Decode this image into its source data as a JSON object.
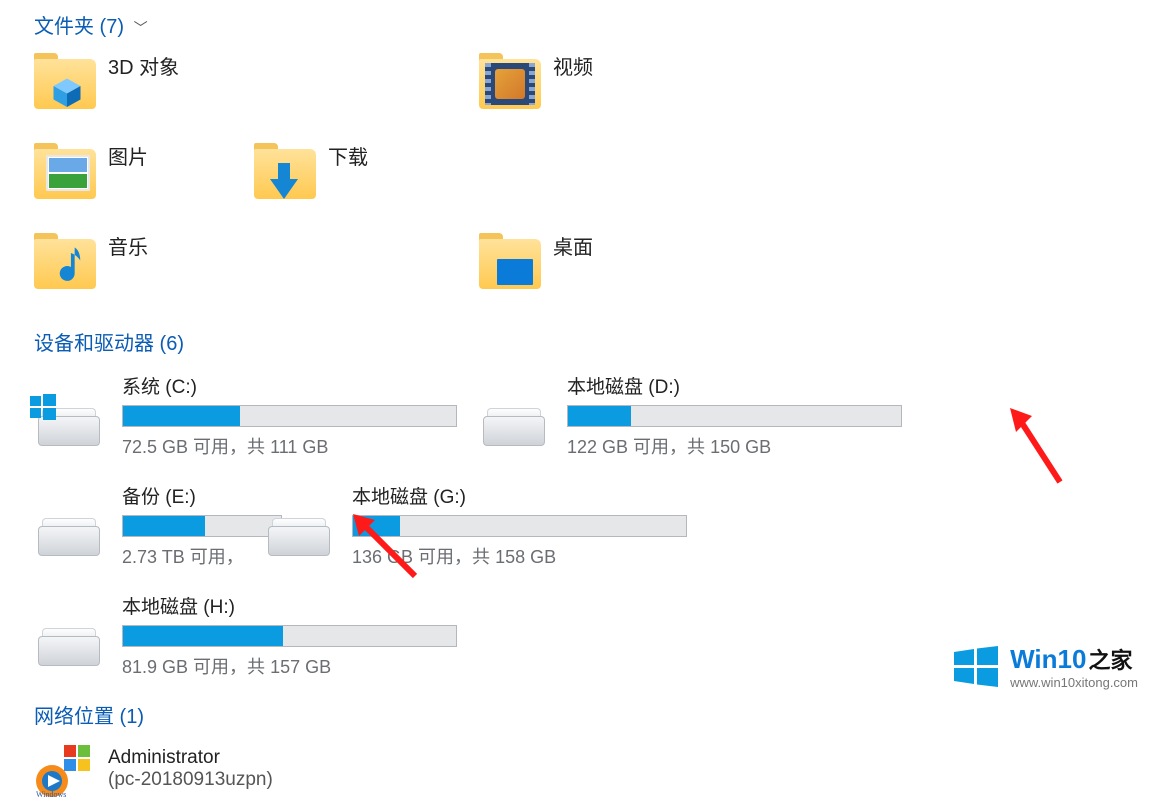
{
  "sections": {
    "folders": {
      "title": "文件夹 (7)"
    },
    "devices": {
      "title": "设备和驱动器 (6)"
    },
    "network": {
      "title": "网络位置 (1)"
    }
  },
  "folders": [
    {
      "id": "3d-objects",
      "label": "3D 对象",
      "icon": "cube"
    },
    {
      "id": "videos",
      "label": "视频",
      "icon": "film"
    },
    {
      "id": "pictures",
      "label": "图片",
      "icon": "picture"
    },
    {
      "id": "downloads",
      "label": "下载",
      "icon": "arrow-down"
    },
    {
      "id": "music",
      "label": "音乐",
      "icon": "note"
    },
    {
      "id": "desktop",
      "label": "桌面",
      "icon": "desktop"
    }
  ],
  "drives": [
    {
      "name": "系统 (C:)",
      "free": "72.5 GB",
      "total": "111 GB",
      "used_pct": 35,
      "accent": "#0a9be0",
      "is_system": true
    },
    {
      "name": "本地磁盘 (D:)",
      "free": "122 GB",
      "total": "150 GB",
      "used_pct": 19,
      "accent": "#0a9be0",
      "is_system": false
    },
    {
      "name": "备份 (E:)",
      "free": "2.73 TB",
      "total": "",
      "used_pct": 52,
      "accent": "#0a9be0",
      "is_system": false,
      "truncated": true
    },
    {
      "name": "本地磁盘 (G:)",
      "free": "136 GB",
      "total": "158 GB",
      "used_pct": 14,
      "accent": "#0a9be0",
      "is_system": false
    },
    {
      "name": "本地磁盘 (H:)",
      "free": "81.9 GB",
      "total": "157 GB",
      "used_pct": 48,
      "accent": "#0a9be0",
      "is_system": false
    }
  ],
  "drive_text_tpl": {
    "sep": " 可用，共 ",
    "free_suffix": " 可用，"
  },
  "network": {
    "label": "Administrator",
    "sub": "(pc-20180913uzpn)",
    "app": "Windows Media Player"
  },
  "watermark": {
    "brand": "Win10",
    "brand_suffix": "之家",
    "url": "www.win10xitong.com"
  }
}
